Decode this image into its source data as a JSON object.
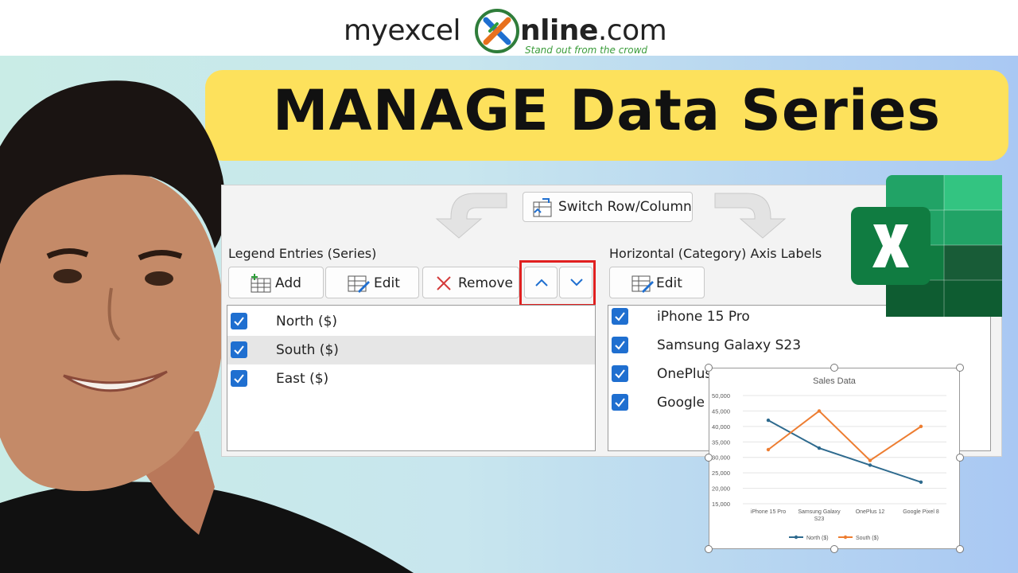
{
  "brand": {
    "name_pre": "myexcel",
    "name_post": "nline",
    "name_suffix": ".com",
    "tagline": "Stand out from the crowd"
  },
  "title": "MANAGE Data Series",
  "dialog": {
    "switch_button": "Switch Row/Column",
    "legend_label": "Legend Entries (Series)",
    "axis_label": "Horizontal (Category) Axis Labels",
    "legend_toolbar": {
      "add": "Add",
      "edit": "Edit",
      "remove": "Remove",
      "move_up": "move-up",
      "move_down": "move-down"
    },
    "axis_toolbar": {
      "edit": "Edit"
    },
    "series": [
      {
        "label": "North ($)",
        "checked": true,
        "selected": false
      },
      {
        "label": "South ($)",
        "checked": true,
        "selected": true
      },
      {
        "label": "East ($)",
        "checked": true,
        "selected": false
      }
    ],
    "categories": [
      {
        "label": "iPhone 15 Pro",
        "checked": true
      },
      {
        "label": "Samsung Galaxy S23",
        "checked": true
      },
      {
        "label": "OnePlus 12",
        "checked": true
      },
      {
        "label": "Google Pixel 8",
        "checked": true
      }
    ]
  },
  "icons": {
    "add": "table-add-icon",
    "edit": "table-edit-icon",
    "remove": "close-icon",
    "switch": "switch-row-column-icon",
    "excel": "excel-logo-icon",
    "brand": "x-logo-icon"
  },
  "colors": {
    "accent_blue": "#1f6fd0",
    "highlight_red": "#e02020",
    "banner_yellow": "#fde15c",
    "north": "#2e6a8e",
    "south": "#ed7d31",
    "excel_green": "#107c41"
  },
  "chart_data": {
    "type": "line",
    "title": "Sales Data",
    "categories": [
      "iPhone 15 Pro",
      "Samsung Galaxy\nS23",
      "OnePlus 12",
      "Google Pixel 8"
    ],
    "series": [
      {
        "name": "North ($)",
        "values": [
          42000,
          33000,
          27500,
          22000
        ],
        "color": "#2e6a8e"
      },
      {
        "name": "South ($)",
        "values": [
          32500,
          45000,
          29000,
          40000
        ],
        "color": "#ed7d31"
      }
    ],
    "yticks": [
      "50,000",
      "45,000",
      "40,000",
      "35,000",
      "30,000",
      "25,000",
      "20,000",
      "15,000"
    ],
    "ylim": [
      15000,
      50000
    ],
    "legend": "bottom"
  }
}
